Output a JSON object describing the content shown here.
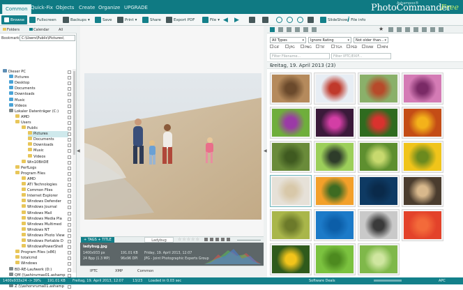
{
  "menu": {
    "tabs": [
      "Common",
      "Quick-Fix",
      "Objects",
      "Create",
      "Organize",
      "UPGRADE"
    ],
    "active": "Common"
  },
  "branding": {
    "small": "Ashampoo®",
    "main": "PhotoCommander",
    "free": "Free"
  },
  "toolbar": {
    "browse": "Browse",
    "fullscreen": "Fullscreen",
    "backups": "Backups",
    "save": "Save",
    "print": "Print",
    "share": "Share",
    "export_pdf": "Export PDF",
    "file": "File",
    "slideshow": "SlideShow",
    "file_info": "File info"
  },
  "left": {
    "tab_folders": "Folders",
    "tab_calendar": "Calendar",
    "tab_all": "All",
    "bookmarks_label": "Bookmarks",
    "path": "C:\\Users\\Public\\Pictures\\",
    "tree": [
      {
        "label": "Dieser PC",
        "depth": 0,
        "kind": "pc"
      },
      {
        "label": "Pictures",
        "depth": 1,
        "kind": "blue"
      },
      {
        "label": "Desktop",
        "depth": 1,
        "kind": "blue"
      },
      {
        "label": "Documents",
        "depth": 1,
        "kind": "blue"
      },
      {
        "label": "Downloads",
        "depth": 1,
        "kind": "blue"
      },
      {
        "label": "Music",
        "depth": 1,
        "kind": "blue"
      },
      {
        "label": "Videos",
        "depth": 1,
        "kind": "blue"
      },
      {
        "label": "Lokaler Datenträger (C:)",
        "depth": 1,
        "kind": "drive"
      },
      {
        "label": "AMD",
        "depth": 2,
        "kind": "folder"
      },
      {
        "label": "Users",
        "depth": 2,
        "kind": "folder"
      },
      {
        "label": "Public",
        "depth": 3,
        "kind": "folder"
      },
      {
        "label": "Pictures",
        "depth": 4,
        "kind": "folder",
        "selected": true
      },
      {
        "label": "Documents",
        "depth": 4,
        "kind": "folder"
      },
      {
        "label": "Downloads",
        "depth": 4,
        "kind": "folder"
      },
      {
        "label": "Music",
        "depth": 4,
        "kind": "folder"
      },
      {
        "label": "Videos",
        "depth": 4,
        "kind": "folder"
      },
      {
        "label": "Win10BitDE",
        "depth": 3,
        "kind": "folder"
      },
      {
        "label": "PerfLogs",
        "depth": 2,
        "kind": "folder"
      },
      {
        "label": "Program Files",
        "depth": 2,
        "kind": "folder"
      },
      {
        "label": "AMD",
        "depth": 3,
        "kind": "folder"
      },
      {
        "label": "ATI Technologies",
        "depth": 3,
        "kind": "folder"
      },
      {
        "label": "Common Files",
        "depth": 3,
        "kind": "folder"
      },
      {
        "label": "Internet Explorer",
        "depth": 3,
        "kind": "folder"
      },
      {
        "label": "Windows Defender",
        "depth": 3,
        "kind": "folder"
      },
      {
        "label": "Windows Journal",
        "depth": 3,
        "kind": "folder"
      },
      {
        "label": "Windows Mail",
        "depth": 3,
        "kind": "folder"
      },
      {
        "label": "Windows Media Pla",
        "depth": 3,
        "kind": "folder"
      },
      {
        "label": "Windows Multimed",
        "depth": 3,
        "kind": "folder"
      },
      {
        "label": "Windows NT",
        "depth": 3,
        "kind": "folder"
      },
      {
        "label": "Windows Photo View",
        "depth": 3,
        "kind": "folder"
      },
      {
        "label": "Windows Portable D",
        "depth": 3,
        "kind": "folder"
      },
      {
        "label": "WindowsPowerShell",
        "depth": 3,
        "kind": "folder"
      },
      {
        "label": "Program Files (x86)",
        "depth": 2,
        "kind": "folder"
      },
      {
        "label": "totalcmd",
        "depth": 2,
        "kind": "folder"
      },
      {
        "label": "Windows",
        "depth": 2,
        "kind": "folder"
      },
      {
        "label": "BD-RE-Laufwerk (D:)",
        "depth": 1,
        "kind": "drive"
      },
      {
        "label": "QM (\\\\ashinvmas01.ashamp",
        "depth": 1,
        "kind": "drive"
      },
      {
        "label": "FileSharing (\\\\ashstordata01)",
        "depth": 1,
        "kind": "drive"
      },
      {
        "label": "Z (\\\\ashorvruma01.ashamp",
        "depth": 1,
        "kind": "drive"
      }
    ]
  },
  "preview": {
    "tags_label": "TAGS",
    "title_label": "TITLE",
    "filename": "Ladybug",
    "info": {
      "file": "ladybug.jpg",
      "dims": "1400x933 px",
      "size": "191.01 KB",
      "date": "Friday, 19. April 2013, 12:07",
      "bpp": "24 Bpp (1.3 MP)",
      "dpi": "96x96 DPI",
      "format": "JPG - Joint Photographic Experts Group"
    },
    "info_tabs": [
      "IPTC",
      "XMP",
      "Common"
    ]
  },
  "right": {
    "type_select": "All Types",
    "rating_select": "Ignore Rating",
    "age_select": "Not older than...",
    "checkboxes": [
      "GIF",
      "JPG",
      "PNG",
      "TIF",
      "TGA",
      "PSD",
      "RAW",
      "MP4"
    ],
    "filter_name_placeholder": "Filter Filename...",
    "filter_iptc_placeholder": "Filter IPTC/EXIF...",
    "date_header": "Freitag, 19. April 2013 (23)",
    "thumbs": [
      {
        "name": "thumb-lizard",
        "c1": "#b58a5c",
        "c2": "#6b4a2c"
      },
      {
        "name": "thumb-butterfly",
        "c1": "#e7edf4",
        "c2": "#c0392b"
      },
      {
        "name": "thumb-crab",
        "c1": "#8ab06a",
        "c2": "#b74a2a"
      },
      {
        "name": "thumb-pink-flower",
        "c1": "#d47bb5",
        "c2": "#7a2a66"
      },
      {
        "name": "thumb-purple-flower",
        "c1": "#6fae3c",
        "c2": "#9b3aa6"
      },
      {
        "name": "thumb-magenta-flower",
        "c1": "#3b1a3a",
        "c2": "#d33ea5"
      },
      {
        "name": "thumb-red-flower",
        "c1": "#2f6b1f",
        "c2": "#d9322e"
      },
      {
        "name": "thumb-berries",
        "c1": "#c44d16",
        "c2": "#f4b21a"
      },
      {
        "name": "thumb-grasshopper",
        "c1": "#6a8b3a",
        "c2": "#3f5a20"
      },
      {
        "name": "thumb-beetle",
        "c1": "#9ccf5a",
        "c2": "#2e3c2a"
      },
      {
        "name": "thumb-dragonfly",
        "c1": "#5e8f2f",
        "c2": "#c7d96e"
      },
      {
        "name": "thumb-yellow-flower",
        "c1": "#f0c41a",
        "c2": "#6b8a1e"
      },
      {
        "name": "thumb-beach-family",
        "c1": "#e6e1d8",
        "c2": "#d8c8a9"
      },
      {
        "name": "thumb-sunset",
        "c1": "#f3a02a",
        "c2": "#3d6b22"
      },
      {
        "name": "thumb-moon",
        "c1": "#0e3a63",
        "c2": "#0a2a4a"
      },
      {
        "name": "thumb-mushrooms",
        "c1": "#4a3c2e",
        "c2": "#d8b88c"
      },
      {
        "name": "thumb-caterpillar",
        "c1": "#a9b64a",
        "c2": "#6c7a2a"
      },
      {
        "name": "thumb-plane",
        "c1": "#1c7ac8",
        "c2": "#0c5ea8"
      },
      {
        "name": "thumb-old-portrait",
        "c1": "#c9c9c9",
        "c2": "#3a3a3a"
      },
      {
        "name": "thumb-red-petals",
        "c1": "#e3422a",
        "c2": "#f36a3a"
      },
      {
        "name": "thumb-sunflower",
        "c1": "#2f5a1c",
        "c2": "#f2c41b"
      },
      {
        "name": "thumb-frog",
        "c1": "#7bc23f",
        "c2": "#4d8a1f"
      },
      {
        "name": "thumb-green-landscape",
        "c1": "#7fb84a",
        "c2": "#cfe6a0"
      }
    ]
  },
  "status": {
    "dims": "1400x933x24 -> 39%",
    "size": "191.01 KB",
    "date": "Freitag, 19. April 2013, 12:07",
    "index": "13/23",
    "loaded": "Loaded in 0.03 sec",
    "deals": "Software Deals",
    "apc": "APC"
  }
}
